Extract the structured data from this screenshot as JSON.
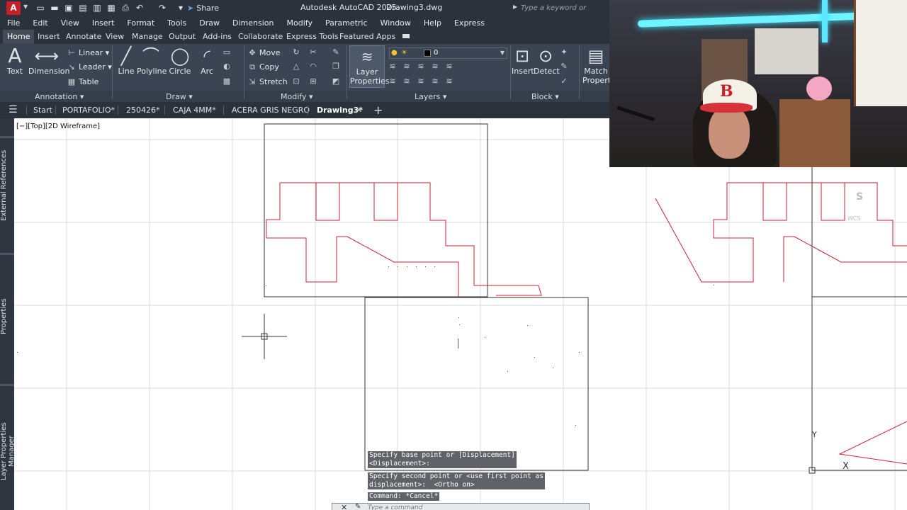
{
  "app": {
    "logo_letter": "A",
    "app_title": "Autodesk AutoCAD 2025",
    "doc_title": "Drawing3.dwg",
    "share_label": "Share",
    "search_placeholder": "Type a keyword or phrase"
  },
  "menu": [
    "File",
    "Edit",
    "View",
    "Insert",
    "Format",
    "Tools",
    "Draw",
    "Dimension",
    "Modify",
    "Parametric",
    "Window",
    "Help",
    "Express"
  ],
  "ribbon_tabs": [
    "Home",
    "Insert",
    "Annotate",
    "View",
    "Manage",
    "Output",
    "Add-ins",
    "Collaborate",
    "Express Tools",
    "Featured Apps"
  ],
  "ribbon": {
    "annotation": {
      "title": "Annotation",
      "text": "Text",
      "dimension": "Dimension",
      "linear": "Linear",
      "leader": "Leader",
      "table": "Table"
    },
    "draw": {
      "title": "Draw",
      "line": "Line",
      "polyline": "Polyline",
      "circle": "Circle",
      "arc": "Arc"
    },
    "modify": {
      "title": "Modify",
      "move": "Move",
      "copy": "Copy",
      "stretch": "Stretch"
    },
    "layers": {
      "title": "Layers",
      "layer_properties_1": "Layer",
      "layer_properties_2": "Properties",
      "current_layer": "0"
    },
    "block": {
      "title": "Block",
      "insert": "Insert",
      "detect": "Detect",
      "match_1": "Match",
      "match_2": "Properties"
    }
  },
  "file_tabs": [
    "Start",
    "PORTAFOLIO*",
    "250426*",
    "CAJA 4MM*",
    "ACERA GRIS NEGRO",
    "Drawing3*"
  ],
  "palettes": [
    "External References",
    "Properties",
    "Layer Properties Manager"
  ],
  "viewport_label": "[−][Top][2D Wireframe]",
  "command_history": [
    "Specify base point or [Displacement]\n<Displacement>:",
    "Specify second point or <use first point as\ndisplacement>:  <Ortho on>",
    "Command: *Cancel*"
  ],
  "command_placeholder": "Type a command",
  "viewcube": {
    "face": "S",
    "wcs": "WCS"
  },
  "ucs": {
    "y": "Y",
    "x": "X"
  },
  "colors": {
    "title_bg": "#2b323c",
    "ribbon_bg": "#3b4452",
    "geometry": "#cc2233",
    "outline": "#222222",
    "grid": "#d6d9dd"
  }
}
